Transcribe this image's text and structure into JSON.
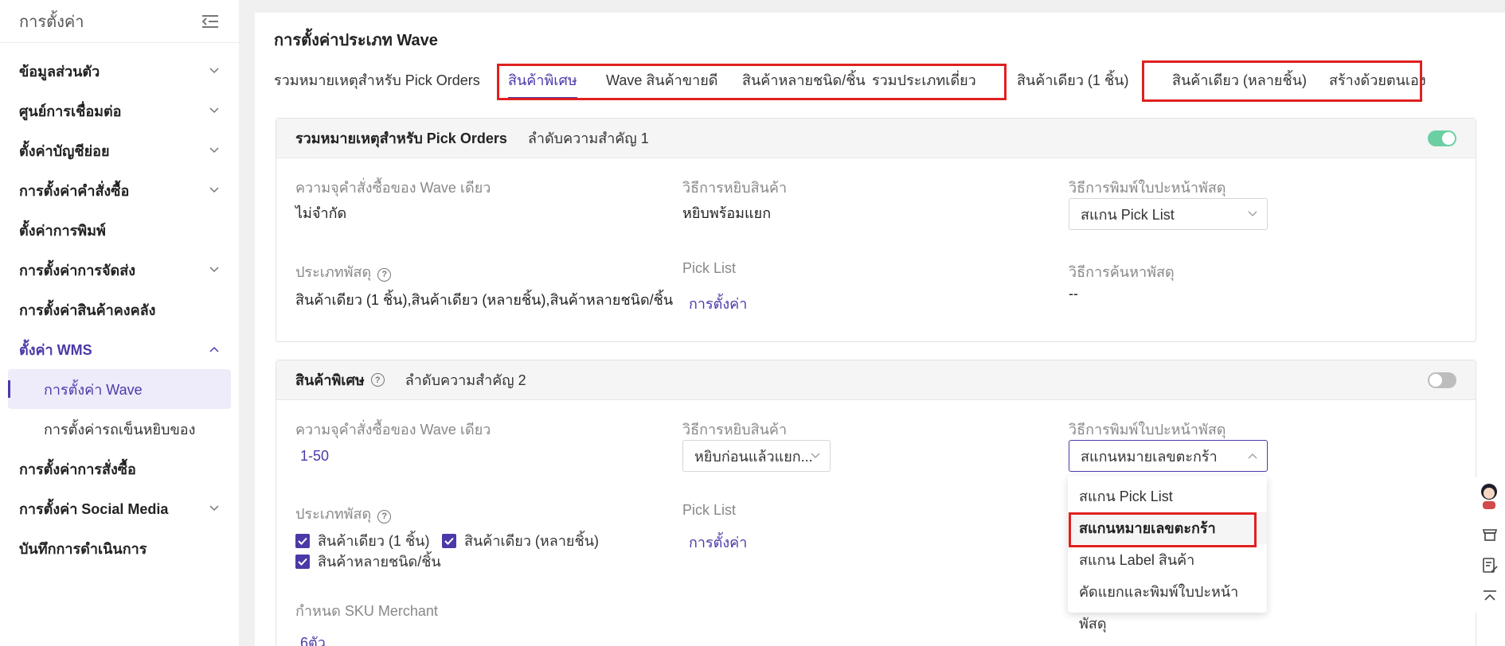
{
  "sidebar": {
    "title": "การตั้งค่า",
    "items": [
      {
        "label": "ข้อมูลส่วนตัว"
      },
      {
        "label": "ศูนย์การเชื่อมต่อ"
      },
      {
        "label": "ตั้งค่าบัญชีย่อย"
      },
      {
        "label": "การตั้งค่าคำสั่งซื้อ"
      },
      {
        "label": "ตั้งค่าการพิมพ์"
      },
      {
        "label": "การตั้งค่าการจัดส่ง"
      },
      {
        "label": "การตั้งค่าสินค้าคงคลัง"
      },
      {
        "label": "ตั้งค่า WMS"
      },
      {
        "label": "การตั้งค่าการสั่งซื้อ"
      },
      {
        "label": "การตั้งค่า Social Media"
      },
      {
        "label": "บันทึกการดำเนินการ"
      }
    ],
    "sub_items": [
      {
        "label": "การตั้งค่า Wave"
      },
      {
        "label": "การตั้งค่ารถเข็นหยิบของ"
      }
    ]
  },
  "main": {
    "title": "การตั้งค่าประเภท Wave",
    "tabs": [
      {
        "label": "รวมหมายเหตุสำหรับ Pick Orders"
      },
      {
        "label": "สินค้าพิเศษ"
      },
      {
        "label": "Wave สินค้าขายดี"
      },
      {
        "label": "สินค้าหลายชนิด/ชิ้น"
      },
      {
        "label": "รวมประเภทเดี่ยว"
      },
      {
        "label": "สินค้าเดียว (1 ชิ้น)"
      },
      {
        "label": "สินค้าเดียว (หลายชิ้น)"
      },
      {
        "label": "สร้างด้วยตนเอง"
      }
    ]
  },
  "card1": {
    "title": "รวมหมายเหตุสำหรับ Pick Orders",
    "priority": "ลำดับความสำคัญ 1",
    "capacity_label": "ความจุคำสั่งซื้อของ Wave เดียว",
    "capacity_value": "ไม่จำกัด",
    "pick_method_label": "วิธีการหยิบสินค้า",
    "pick_method_value": "หยิบพร้อมแยก",
    "print_method_label": "วิธีการพิมพ์ใบปะหน้าพัสดุ",
    "print_method_value": "สแกน Pick List",
    "parcel_type_label": "ประเภทพัสดุ",
    "parcel_type_value": "สินค้าเดียว (1 ชิ้น),สินค้าเดียว (หลายชิ้น),สินค้าหลายชนิด/ชิ้น",
    "pick_list_label": "Pick List",
    "pick_list_link": "การตั้งค่า",
    "search_method_label": "วิธีการค้นหาพัสดุ",
    "search_method_value": "--"
  },
  "card2": {
    "title": "สินค้าพิเศษ",
    "priority": "ลำดับความสำคัญ 2",
    "capacity_label": "ความจุคำสั่งซื้อของ Wave เดียว",
    "capacity_value": "1-50",
    "pick_method_label": "วิธีการหยิบสินค้า",
    "pick_method_value": "หยิบก่อนแล้วแยก...",
    "print_method_label": "วิธีการพิมพ์ใบปะหน้าพัสดุ",
    "print_method_value": "สแกนหมายเลขตะกร้า",
    "parcel_type_label": "ประเภทพัสดุ",
    "parcel_types": [
      {
        "label": "สินค้าเดียว (1 ชิ้น)"
      },
      {
        "label": "สินค้าเดียว (หลายชิ้น)"
      },
      {
        "label": "สินค้าหลายชนิด/ชิ้น"
      }
    ],
    "pick_list_label": "Pick List",
    "pick_list_link": "การตั้งค่า",
    "sku_label": "กำหนด SKU Merchant",
    "sku_value": "6ตัว"
  },
  "dropdown": {
    "options": [
      {
        "label": "สแกน Pick List"
      },
      {
        "label": "สแกนหมายเลขตะกร้า"
      },
      {
        "label": "สแกน Label สินค้า"
      },
      {
        "label": "คัดแยกและพิมพ์ใบปะหน้าพัสดุ"
      }
    ]
  },
  "colors": {
    "accent": "#4a3aa8",
    "toggle_on": "#6ccfa4",
    "highlight": "#e02020"
  }
}
